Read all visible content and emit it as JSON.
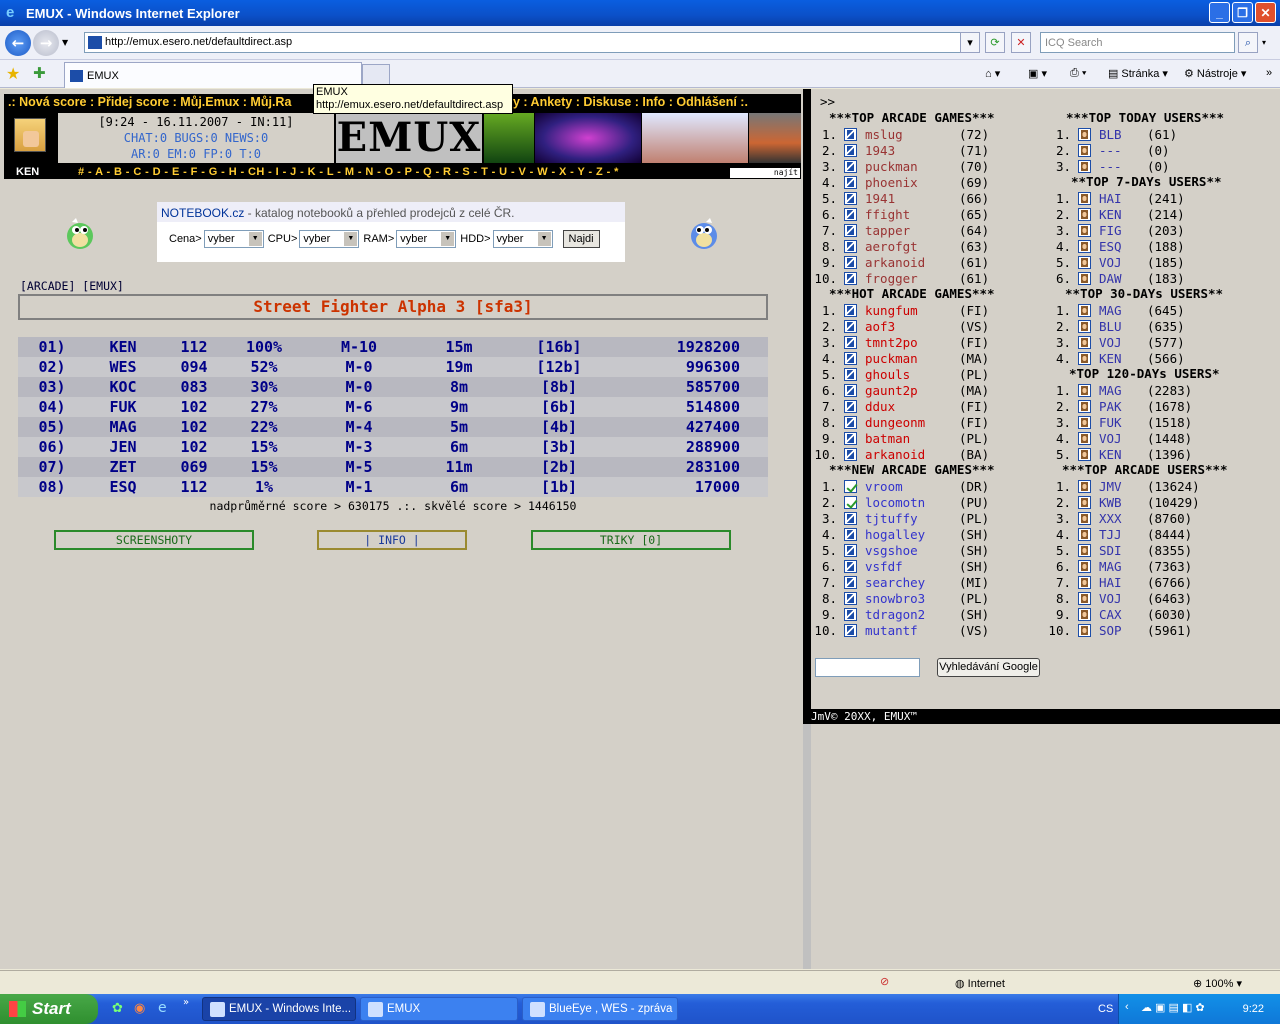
{
  "window": {
    "title": "EMUX - Windows Internet Explorer"
  },
  "browser": {
    "url": "http://emux.esero.net/defaultdirect.asp",
    "search_placeholder": "ICQ Search",
    "tab_title": "EMUX",
    "tools": {
      "page": "Stránka",
      "tools": "Nástroje"
    },
    "tooltip": {
      "title": "EMUX",
      "url": "http://emux.esero.net/defaultdirect.asp"
    }
  },
  "site": {
    "topmenu": ".: Nová score : Přidej score : Můj.Emux : Můj.Ra",
    "topmenu_right": "edky : Ankety : Diskuse : Info : Odhlášení :.",
    "info_line1": "[9:24 - 16.11.2007 - IN:11]",
    "info_line2": "CHAT:0 BUGS:0 NEWS:0",
    "info_line3": "AR:0 EM:0 FP:0 T:0",
    "logo": "EMUX",
    "user": "KEN",
    "letters": "# - A - B - C - D - E - F - G - H - CH - I - J - K - L - M - N - O - P - Q - R - S - T - U - V - W - X - Y - Z - *",
    "search_btn": "najít"
  },
  "notebook": {
    "brand": "NOTEBOOK.cz",
    "desc": " - katalog notebooků a přehled prodejců z celé ČR.",
    "labels": [
      "Cena>",
      "CPU>",
      "RAM>",
      "HDD>"
    ],
    "select_value": "vyber",
    "button": "Najdi"
  },
  "crumbs": "[ARCADE] [EMUX]",
  "game_title": "Street Fighter Alpha 3 [sfa3]",
  "scores": [
    [
      "01)",
      "KEN",
      "112",
      "100%",
      "M-10",
      "15m",
      "[16b]",
      "1928200"
    ],
    [
      "02)",
      "WES",
      "094",
      "52%",
      "M-0",
      "19m",
      "[12b]",
      "996300"
    ],
    [
      "03)",
      "KOC",
      "083",
      "30%",
      "M-0",
      "8m",
      "[8b]",
      "585700"
    ],
    [
      "04)",
      "FUK",
      "102",
      "27%",
      "M-6",
      "9m",
      "[6b]",
      "514800"
    ],
    [
      "05)",
      "MAG",
      "102",
      "22%",
      "M-4",
      "5m",
      "[4b]",
      "427400"
    ],
    [
      "06)",
      "JEN",
      "102",
      "15%",
      "M-3",
      "6m",
      "[3b]",
      "288900"
    ],
    [
      "07)",
      "ZET",
      "069",
      "15%",
      "M-5",
      "11m",
      "[2b]",
      "283100"
    ],
    [
      "08)",
      "ESQ",
      "112",
      "1%",
      "M-1",
      "6m",
      "[1b]",
      "17000"
    ]
  ],
  "score_footer": "nadprůměrné score > 630175  .:.  skvělé score > 1446150",
  "buttons": {
    "screens": "SCREENSHOTY",
    "info": "| INFO |",
    "tricks": "TRIKY [0]"
  },
  "right": {
    "marker": ">>",
    "top_games_title": "***TOP ARCADE GAMES***",
    "top_games": [
      [
        "1.",
        "mslug",
        "(72)"
      ],
      [
        "2.",
        "1943",
        "(71)"
      ],
      [
        "3.",
        "puckman",
        "(70)"
      ],
      [
        "4.",
        "phoenix",
        "(69)"
      ],
      [
        "5.",
        "1941",
        "(66)"
      ],
      [
        "6.",
        "ffight",
        "(65)"
      ],
      [
        "7.",
        "tapper",
        "(64)"
      ],
      [
        "8.",
        "aerofgt",
        "(63)"
      ],
      [
        "9.",
        "arkanoid",
        "(61)"
      ],
      [
        "10.",
        "frogger",
        "(61)"
      ]
    ],
    "hot_games_title": "***HOT ARCADE GAMES***",
    "hot_games": [
      [
        "1.",
        "kungfum",
        "(FI)"
      ],
      [
        "2.",
        "aof3",
        "(VS)"
      ],
      [
        "3.",
        "tmnt2po",
        "(FI)"
      ],
      [
        "4.",
        "puckman",
        "(MA)"
      ],
      [
        "5.",
        "ghouls",
        "(PL)"
      ],
      [
        "6.",
        "gaunt2p",
        "(MA)"
      ],
      [
        "7.",
        "ddux",
        "(FI)"
      ],
      [
        "8.",
        "dungeonm",
        "(FI)"
      ],
      [
        "9.",
        "batman",
        "(PL)"
      ],
      [
        "10.",
        "arkanoid",
        "(BA)"
      ]
    ],
    "new_games_title": "***NEW ARCADE GAMES***",
    "new_games": [
      [
        "1.",
        "vroom",
        "(DR)"
      ],
      [
        "2.",
        "locomotn",
        "(PU)"
      ],
      [
        "3.",
        "tjtuffy",
        "(PL)"
      ],
      [
        "4.",
        "hogalley",
        "(SH)"
      ],
      [
        "5.",
        "vsgshoe",
        "(SH)"
      ],
      [
        "6.",
        "vsfdf",
        "(SH)"
      ],
      [
        "7.",
        "searchey",
        "(MI)"
      ],
      [
        "8.",
        "snowbro3",
        "(PL)"
      ],
      [
        "9.",
        "tdragon2",
        "(SH)"
      ],
      [
        "10.",
        "mutantf",
        "(VS)"
      ]
    ],
    "today_title": "***TOP TODAY USERS***",
    "today": [
      [
        "1.",
        "BLB",
        "(61)"
      ],
      [
        "2.",
        "---",
        "(0)"
      ],
      [
        "3.",
        "---",
        "(0)"
      ]
    ],
    "d7_title": "**TOP 7-DAYs USERS**",
    "d7": [
      [
        "1.",
        "HAI",
        "(241)"
      ],
      [
        "2.",
        "KEN",
        "(214)"
      ],
      [
        "3.",
        "FIG",
        "(203)"
      ],
      [
        "4.",
        "ESQ",
        "(188)"
      ],
      [
        "5.",
        "VOJ",
        "(185)"
      ],
      [
        "6.",
        "DAW",
        "(183)"
      ]
    ],
    "d30_title": "**TOP 30-DAYs USERS**",
    "d30": [
      [
        "1.",
        "MAG",
        "(645)"
      ],
      [
        "2.",
        "BLU",
        "(635)"
      ],
      [
        "3.",
        "VOJ",
        "(577)"
      ],
      [
        "4.",
        "KEN",
        "(566)"
      ]
    ],
    "d120_title": "*TOP 120-DAYs USERS*",
    "d120": [
      [
        "1.",
        "MAG",
        "(2283)"
      ],
      [
        "2.",
        "PAK",
        "(1678)"
      ],
      [
        "3.",
        "FUK",
        "(1518)"
      ],
      [
        "4.",
        "VOJ",
        "(1448)"
      ],
      [
        "5.",
        "KEN",
        "(1396)"
      ]
    ],
    "users_title": "***TOP ARCADE USERS***",
    "users": [
      [
        "1.",
        "JMV",
        "(13624)"
      ],
      [
        "2.",
        "KWB",
        "(10429)"
      ],
      [
        "3.",
        "XXX",
        "(8760)"
      ],
      [
        "4.",
        "TJJ",
        "(8444)"
      ],
      [
        "5.",
        "SDI",
        "(8355)"
      ],
      [
        "6.",
        "MAG",
        "(7363)"
      ],
      [
        "7.",
        "HAI",
        "(6766)"
      ],
      [
        "8.",
        "VOJ",
        "(6463)"
      ],
      [
        "9.",
        "CAX",
        "(6030)"
      ],
      [
        "10.",
        "SOP",
        "(5961)"
      ]
    ],
    "google_btn": "Vyhledávání Google",
    "copyright": "JmV© 20XX, EMUX™"
  },
  "status": {
    "zone": "Internet",
    "zoom": "100%"
  },
  "taskbar": {
    "start": "Start",
    "tasks": [
      "EMUX - Windows Inte...",
      "EMUX",
      "BlueEye , WES - zpráva"
    ],
    "lang": "CS",
    "clock": "9:22"
  }
}
